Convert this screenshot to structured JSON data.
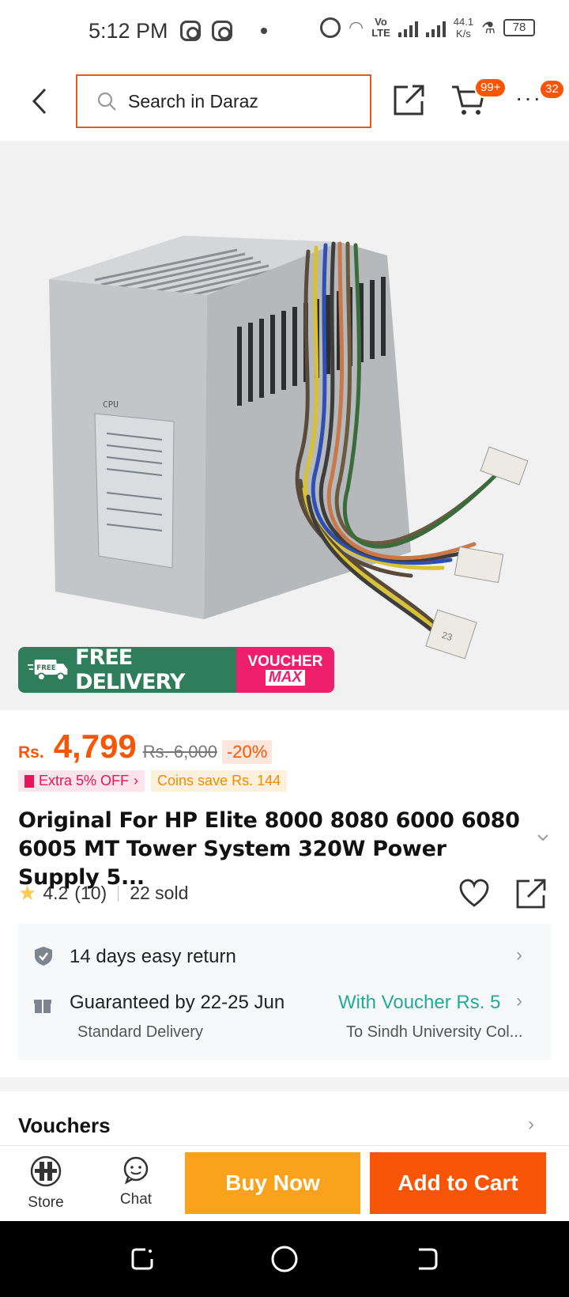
{
  "status_bar": {
    "time": "5:12 PM",
    "volte_top": "Vo",
    "volte_bottom": "LTE",
    "speed_value": "44.1",
    "speed_unit": "K/s",
    "battery": "78"
  },
  "header": {
    "search_placeholder": "Search in Daraz",
    "cart_badge": "99+",
    "more_badge": "32"
  },
  "promo": {
    "free_badge": "FREE",
    "free_delivery": "FREE DELIVERY",
    "voucher_line1": "VOUCHER",
    "voucher_line2": "MAX"
  },
  "price": {
    "currency": "Rs.",
    "amount": "4,799",
    "original": "Rs. 6,000",
    "discount": "-20%"
  },
  "tags": {
    "extra_off": "Extra 5% OFF",
    "coins": "Coins save Rs. 144"
  },
  "product": {
    "title": "Original For HP Elite 8000 8080 6000 6080 6005 MT Tower System 320W Power Supply 5...",
    "rating": "4.2",
    "rating_count": "(10)",
    "sold": "22 sold",
    "image_label_top": "CPU",
    "image_label_num": "23"
  },
  "service": {
    "return_text": "14 days easy return",
    "guarantee_text": "Guaranteed by 22-25 Jun",
    "delivery_type": "Standard Delivery",
    "voucher_text": "With Voucher Rs. 5",
    "location": "To Sindh University Col..."
  },
  "sections": {
    "vouchers": "Vouchers"
  },
  "bottom_bar": {
    "store": "Store",
    "chat": "Chat",
    "buy_now": "Buy Now",
    "add_to_cart": "Add to Cart"
  },
  "colors": {
    "brand_orange": "#f85606",
    "buy_now": "#faa21b",
    "free_delivery_green": "#2f7d5b",
    "voucher_pink": "#ee1f6b",
    "voucher_teal": "#21a99a"
  }
}
